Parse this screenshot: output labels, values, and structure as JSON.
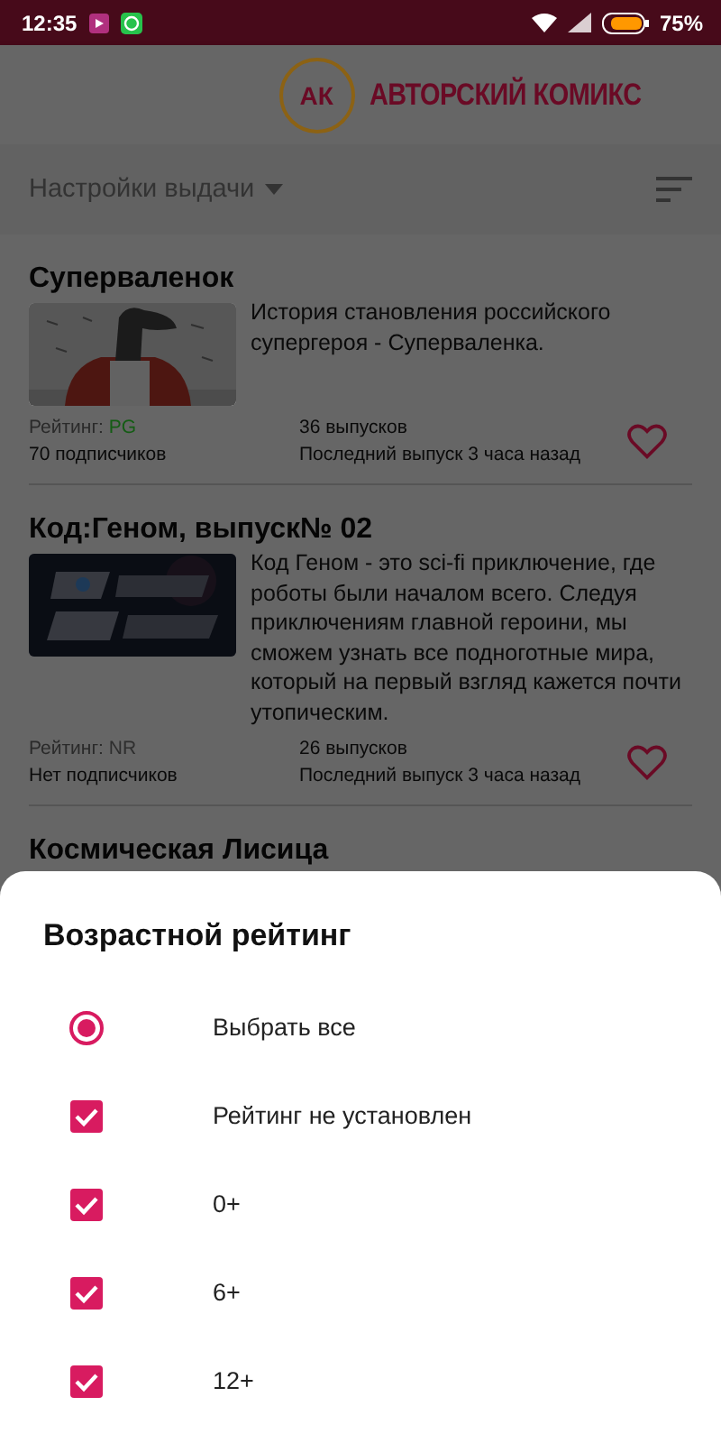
{
  "status_bar": {
    "time": "12:35",
    "battery": "75%"
  },
  "app_bar": {
    "logo_mark": "АК",
    "logo_text": "АВТОРСКИЙ КОМИКС"
  },
  "filter_bar": {
    "label": "Настройки выдачи"
  },
  "comics": [
    {
      "title": "Суперваленок",
      "description": "История становления российского супергероя - Суперваленка.",
      "rating_label": "Рейтинг:",
      "rating": "PG",
      "color": "#145c14",
      "subscribers": "70 подписчиков",
      "issues": "36 выпусков",
      "last_issue": "Последний выпуск 3 часа назад",
      "favorite": false
    },
    {
      "title": "Код:Геном, выпуск№ 02",
      "description": "Код Геном - это sci-fi приключение, где роботы были началом всего. Следуя приключениям главной героини, мы сможем узнать все подноготные мира, который на первый взгляд кажется почти утопическим.",
      "rating_label": "Рейтинг:",
      "rating": "NR",
      "color": "#2e2e2e",
      "subscribers": "Нет подписчиков",
      "issues": "26 выпусков",
      "last_issue": "Последний выпуск 3 часа назад",
      "favorite": false
    },
    {
      "title": "Космическая Лисица"
    }
  ],
  "sheet": {
    "title": "Возрастной рейтинг",
    "options": [
      {
        "kind": "radio",
        "label": "Выбрать все",
        "selected": true
      },
      {
        "kind": "checkbox",
        "label": "Рейтинг не установлен",
        "checked": true
      },
      {
        "kind": "checkbox",
        "label": "0+",
        "checked": true
      },
      {
        "kind": "checkbox",
        "label": "6+",
        "checked": true
      },
      {
        "kind": "checkbox",
        "label": "12+",
        "checked": true
      }
    ]
  }
}
